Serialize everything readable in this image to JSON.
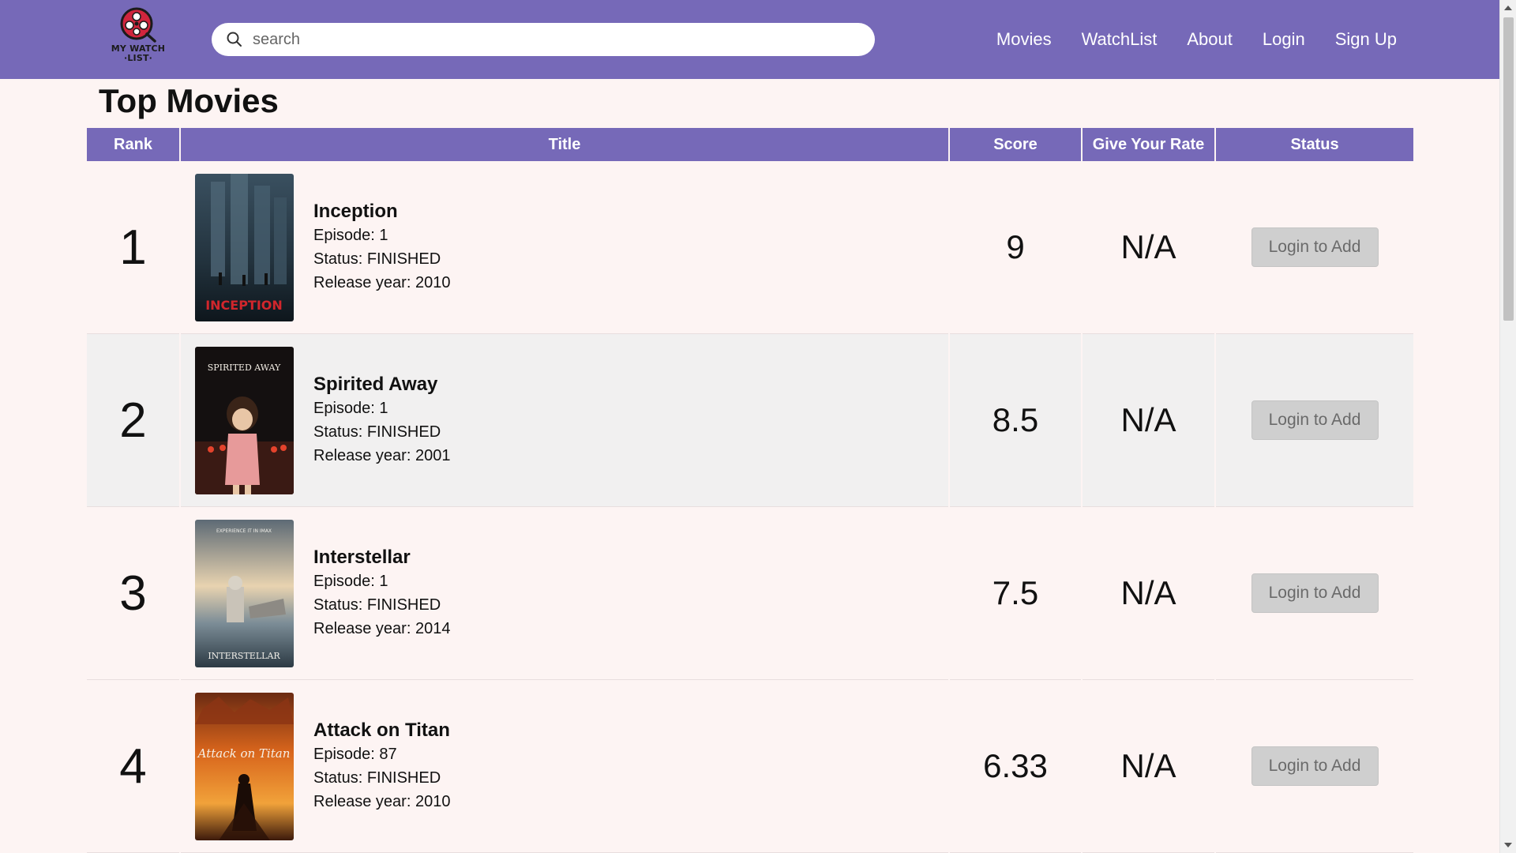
{
  "header": {
    "logo_text_line1": "MY WATCH",
    "logo_text_line2": "·LIST·",
    "search_placeholder": "search",
    "nav": [
      "Movies",
      "WatchList",
      "About",
      "Login",
      "Sign Up"
    ]
  },
  "main": {
    "title": "Top Movies",
    "columns": [
      "Rank",
      "Title",
      "Score",
      "Give Your Rate",
      "Status"
    ],
    "rows": [
      {
        "rank": "1",
        "title": "Inception",
        "episode": "Episode: 1",
        "status": "Status: FINISHED",
        "release": "Release year: 2010",
        "score": "9",
        "rate": "N/A",
        "action": "Login to Add",
        "poster_text": "INCEPTION"
      },
      {
        "rank": "2",
        "title": "Spirited Away",
        "episode": "Episode: 1",
        "status": "Status: FINISHED",
        "release": "Release year: 2001",
        "score": "8.5",
        "rate": "N/A",
        "action": "Login to Add",
        "poster_text": "SPIRITED AWAY"
      },
      {
        "rank": "3",
        "title": "Interstellar",
        "episode": "Episode: 1",
        "status": "Status: FINISHED",
        "release": "Release year: 2014",
        "score": "7.5",
        "rate": "N/A",
        "action": "Login to Add",
        "poster_text": "INTERSTELLAR"
      },
      {
        "rank": "4",
        "title": "Attack on Titan",
        "episode": "Episode: 87",
        "status": "Status: FINISHED",
        "release": "Release year: 2010",
        "score": "6.33",
        "rate": "N/A",
        "action": "Login to Add",
        "poster_text": "Attack on Titan"
      }
    ]
  },
  "colors": {
    "brand": "#7669b8",
    "background": "#fdf4f3",
    "button_bg": "#cfcfcf"
  }
}
